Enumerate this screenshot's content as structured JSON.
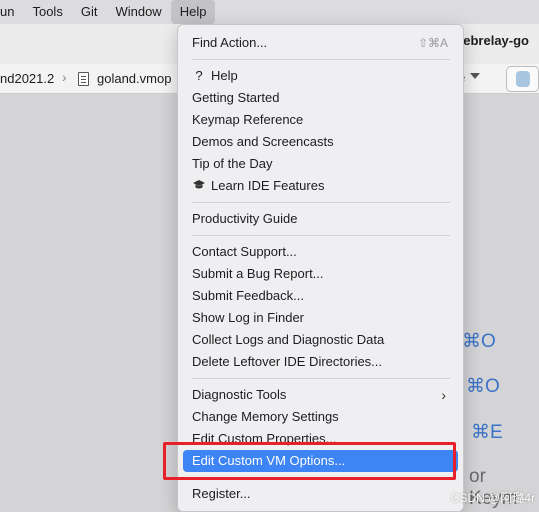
{
  "menubar": {
    "items": [
      "un",
      "Tools",
      "Git",
      "Window",
      "Help"
    ],
    "active_index": 4
  },
  "toolbar": {
    "project_name": "ebrelay-go"
  },
  "navbar": {
    "crumb_project": "nd2021.2",
    "crumb_file": "goland.vmop",
    "trailing_fragment": "e"
  },
  "editor": {
    "hint_shortcut_1": "⌘O",
    "hint_shortcut_2": "⌘O",
    "hint_shortcut_3": "⌘E",
    "hint_text_4": "or Keym"
  },
  "help_menu": {
    "find_action": {
      "label": "Find Action...",
      "shortcut": "⇧⌘A"
    },
    "help": {
      "label": "Help",
      "icon": "question-icon"
    },
    "getting_started": "Getting Started",
    "keymap_reference": "Keymap Reference",
    "demos_screencasts": "Demos and Screencasts",
    "tip_of_the_day": "Tip of the Day",
    "learn_ide": {
      "label": "Learn IDE Features",
      "icon": "graduation-cap-icon"
    },
    "productivity_guide": "Productivity Guide",
    "contact_support": "Contact Support...",
    "submit_bug": "Submit a Bug Report...",
    "submit_feedback": "Submit Feedback...",
    "show_log": "Show Log in Finder",
    "collect_logs": "Collect Logs and Diagnostic Data",
    "delete_leftover": "Delete Leftover IDE Directories...",
    "diagnostic_tools": "Diagnostic Tools",
    "change_memory": "Change Memory Settings",
    "edit_custom_properties": "Edit Custom Properties...",
    "edit_custom_vm": "Edit Custom VM Options...",
    "register": "Register...",
    "selected_item": "Edit Custom VM Options..."
  },
  "watermark": "CSDN @阿璐4r",
  "colors": {
    "selection": "#3d84f5",
    "highlight_box": "#e8202a",
    "hint_blue": "#3a73c8"
  }
}
